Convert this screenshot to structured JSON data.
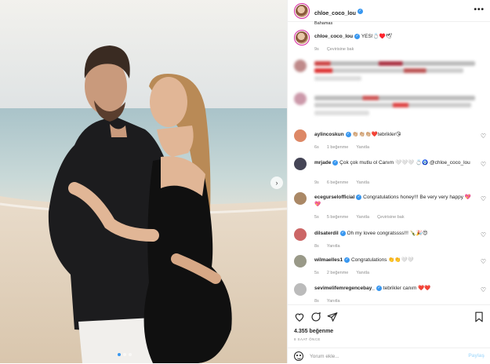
{
  "header": {
    "username": "chloe_coco_lou",
    "location": "Bahamas",
    "more_label": "•••"
  },
  "caption": {
    "username": "chloe_coco_lou",
    "text": "YES!💍♥️🕊",
    "time": "9s",
    "translate": "Çevirisine bak"
  },
  "comments": [
    {
      "username": "aylincoskun",
      "text": "👏🏼👏🏼👏🏼❤️tebrikler😘",
      "time": "6s",
      "likes": "1 beğenme",
      "reply": "Yanıtla",
      "translate": ""
    },
    {
      "username": "mrjade",
      "text": "Çok çok mutlu ol Canım 🤍🤍🤍 💍🧿 @chloe_coco_lou",
      "time": "9s",
      "likes": "6 beğenme",
      "reply": "Yanıtla",
      "translate": ""
    },
    {
      "username": "ecegurselofficial",
      "text": "Congratulations honey!!! Be very very happy 💖💖",
      "time": "5s",
      "likes": "5 beğenme",
      "reply": "Yanıtla",
      "translate": "Çevirisine bak"
    },
    {
      "username": "dilsaterdil",
      "text": "Oh my lovee congratssss!!! 🍾🎉😍",
      "time": "8s",
      "likes": "",
      "reply": "Yanıtla",
      "translate": ""
    },
    {
      "username": "wilmaelles1",
      "text": "Congratulations 👏👏🤍🤍",
      "time": "5s",
      "likes": "2 beğenme",
      "reply": "Yanıtla",
      "translate": ""
    },
    {
      "username": "sevimelifemregencebay_",
      "text": "tebrikler canım ❤️❤️",
      "time": "8s",
      "likes": "",
      "reply": "Yanıtla",
      "translate": ""
    }
  ],
  "footer": {
    "likes": "4.355 beğenme",
    "date": "8 SAAT ÖNCE",
    "comment_placeholder": "Yorum ekle...",
    "post_label": "Paylaş"
  },
  "colors": {
    "accent": "#3897f0",
    "text": "#262626",
    "muted": "#8e8e8e"
  },
  "icons": [
    "heart-icon",
    "comment-icon",
    "share-icon",
    "bookmark-icon",
    "emoji-icon",
    "chevron-right-icon"
  ]
}
